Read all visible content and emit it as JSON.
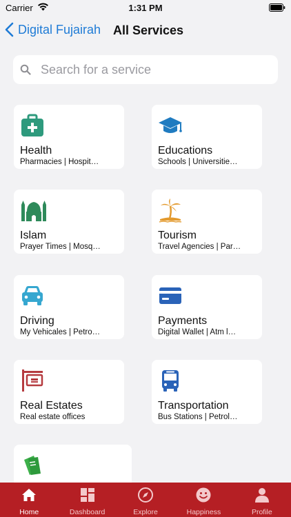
{
  "status_bar": {
    "carrier": "Carrier",
    "time": "1:31 PM"
  },
  "nav": {
    "back_label": "Digital Fujairah",
    "title": "All Services"
  },
  "search": {
    "placeholder": "Search for a service"
  },
  "services": [
    {
      "title": "Health",
      "subtitle": "Pharmacies | Hospit…",
      "icon": "medical-kit-icon",
      "color": "#2e9a7d"
    },
    {
      "title": "Educations",
      "subtitle": "Schools | Universitie…",
      "icon": "graduation-cap-icon",
      "color": "#1f7bc0"
    },
    {
      "title": "Islam",
      "subtitle": "Prayer Times | Mosq…",
      "icon": "mosque-icon",
      "color": "#2e8a5a"
    },
    {
      "title": "Tourism",
      "subtitle": "Travel Agencies | Par…",
      "icon": "palm-tree-icon",
      "color": "#e39a2e"
    },
    {
      "title": "Driving",
      "subtitle": "My Vehicales | Petro…",
      "icon": "car-icon",
      "color": "#36a7d0"
    },
    {
      "title": "Payments",
      "subtitle": "Digital Wallet | Atm l…",
      "icon": "credit-card-icon",
      "color": "#2a63b8"
    },
    {
      "title": "Real Estates",
      "subtitle": "Real estate offices",
      "icon": "real-estate-sign-icon",
      "color": "#b53a3f"
    },
    {
      "title": "Transportation",
      "subtitle": "Bus Stations | Petrol…",
      "icon": "bus-icon",
      "color": "#2a63b8"
    },
    {
      "title": "",
      "subtitle": "",
      "icon": "cards-icon",
      "color": "#3db04a"
    }
  ],
  "tab_bar": {
    "background": "#b51f24",
    "items": [
      {
        "label": "Home",
        "icon": "home-icon"
      },
      {
        "label": "Dashboard",
        "icon": "dashboard-icon"
      },
      {
        "label": "Explore",
        "icon": "compass-icon"
      },
      {
        "label": "Happiness",
        "icon": "smiley-icon"
      },
      {
        "label": "Profile",
        "icon": "profile-icon"
      }
    ]
  }
}
